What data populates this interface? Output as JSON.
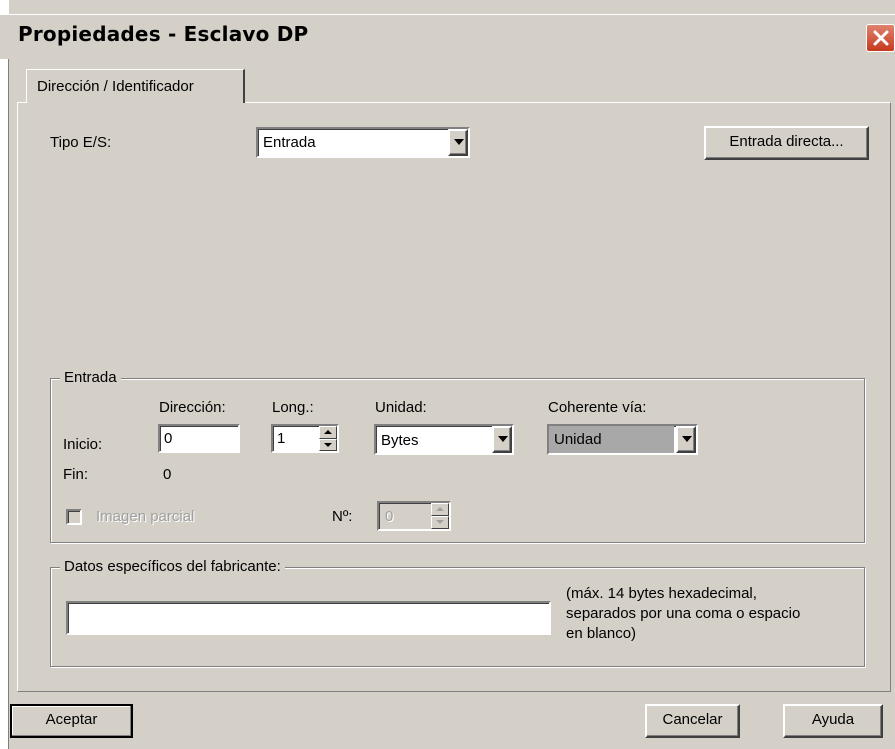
{
  "window": {
    "title": "Propiedades - Esclavo DP"
  },
  "tabs": [
    {
      "label": "Dirección / Identificador"
    }
  ],
  "io": {
    "type_label": "Tipo E/S:",
    "type_value": "Entrada",
    "direct_button": "Entrada directa..."
  },
  "entrada": {
    "legend": "Entrada",
    "headers": {
      "address": "Dirección:",
      "length": "Long.:",
      "unit": "Unidad:",
      "coherent": "Coherente vía:"
    },
    "start_label": "Inicio:",
    "start_address": "0",
    "length": "1",
    "unit": "Bytes",
    "coherent": "Unidad",
    "end_label": "Fin:",
    "end_value": "0",
    "partial_image_label": "Imagen parcial",
    "number_label": "Nº:",
    "number_value": "0"
  },
  "vendor": {
    "legend": "Datos específicos del fabricante:",
    "value": "",
    "hint_lines": [
      "(máx. 14 bytes hexadecimal,",
      "separados por una coma o espacio",
      "en blanco)"
    ]
  },
  "buttons": {
    "ok": "Aceptar",
    "cancel": "Cancelar",
    "help": "Ayuda"
  }
}
